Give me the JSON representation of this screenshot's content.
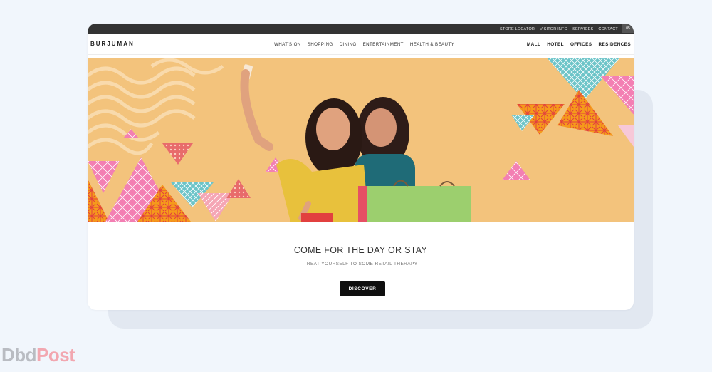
{
  "utility_bar": {
    "links": [
      "STORE LOCATOR",
      "VISITOR INFO",
      "SERVICES",
      "CONTACT"
    ],
    "extra": "05"
  },
  "header": {
    "logo": "BURJUMAN",
    "main_nav": [
      "WHAT'S ON",
      "SHOPPING",
      "DINING",
      "ENTERTAINMENT",
      "HEALTH & BEAUTY"
    ],
    "side_nav": [
      "MALL",
      "HOTEL",
      "OFFICES",
      "RESIDENCES"
    ]
  },
  "hero": {
    "colors": {
      "background": "#f3c37c",
      "pink": "#f37fb3",
      "teal": "#6cc4c8",
      "orange": "#f59a1b",
      "red": "#e2403f",
      "green": "#9ccf6e"
    }
  },
  "cta": {
    "headline": "COME FOR THE DAY OR STAY",
    "subline": "TREAT YOURSELF TO SOME RETAIL THERAPY",
    "button_label": "DISCOVER"
  },
  "watermark": {
    "part1": "Dbd",
    "part2": "Post"
  }
}
